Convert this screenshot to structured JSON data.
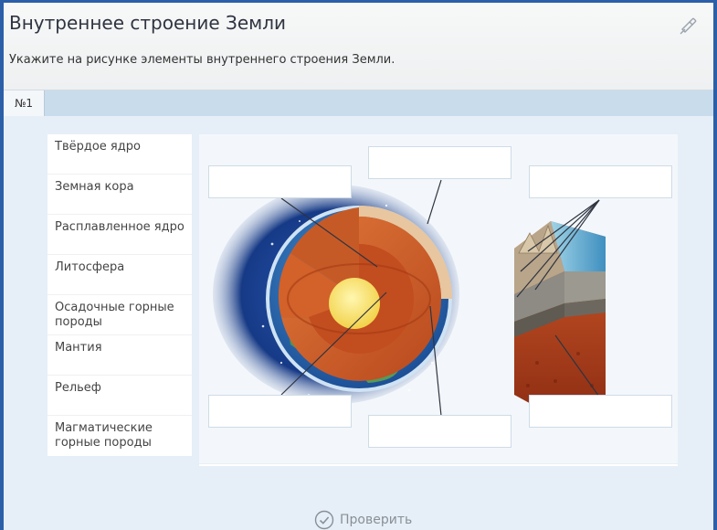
{
  "header": {
    "title": "Внутреннее строение Земли",
    "instruction": "Укажите на рисунке элементы внутреннего строения Земли."
  },
  "tabs": [
    {
      "label": "№1"
    }
  ],
  "word_bank": [
    {
      "label": "Твёрдое ядро"
    },
    {
      "label": "Земная кора"
    },
    {
      "label": "Расплавленное ядро"
    },
    {
      "label": "Литосфера"
    },
    {
      "label": "Осадочные горные породы"
    },
    {
      "label": "Мантия"
    },
    {
      "label": "Рельеф"
    },
    {
      "label": "Магматические горные породы"
    }
  ],
  "check_button": {
    "label": "Проверить"
  },
  "colors": {
    "accent": "#2b5fa8",
    "tab_bar": "#c9dcec",
    "content_bg": "#e6eff7"
  }
}
